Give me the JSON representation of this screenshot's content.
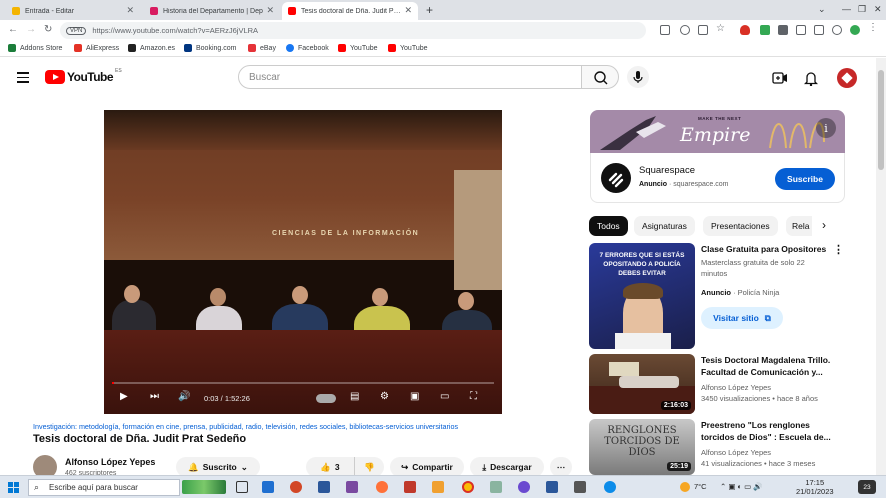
{
  "browser": {
    "tabs": [
      {
        "title": "Entrada - Editar",
        "color": "#f4b400"
      },
      {
        "title": "Historia del Departamento | Dep",
        "color": "#d81b60"
      },
      {
        "title": "Tesis doctoral de Dña. Judit Prat",
        "color": "#ff0000",
        "active": true
      }
    ],
    "new_tab": "+",
    "url": "https://www.youtube.com/watch?v=AERzJ6jVLRA",
    "url_badge": "VPN",
    "bookmarks": [
      {
        "label": "Addons Store",
        "color": "#1b7d3a"
      },
      {
        "label": "AliExpress",
        "color": "#e43226"
      },
      {
        "label": "Amazon.es",
        "color": "#222222"
      },
      {
        "label": "Booking.com",
        "color": "#003580"
      },
      {
        "label": "eBay",
        "color": "#e53238"
      },
      {
        "label": "Facebook",
        "color": "#1877f2"
      },
      {
        "label": "YouTube",
        "color": "#ff0000"
      },
      {
        "label": "YouTube",
        "color": "#ff0000"
      }
    ]
  },
  "youtube": {
    "logo_text": "YouTube",
    "country_code": "ES",
    "search_placeholder": "Buscar"
  },
  "player": {
    "banner_text": "CIENCIAS DE LA INFORMACIÓN",
    "time": "0:03 / 1:52:26",
    "progress": 0.0004
  },
  "video": {
    "hashtags": "Investigación: metodología, formación en cine, prensa, publicidad, radio, televisión, redes sociales, bibliotecas-servicios universitarios",
    "title": "Tesis doctoral de Dña. Judit Prat Sedeño",
    "channel": "Alfonso López Yepes",
    "subscribers": "462 suscriptores",
    "subscribed_label": "Suscrito",
    "likes": "3",
    "share_label": "Compartir",
    "download_label": "Descargar"
  },
  "ad": {
    "banner_small": "MAKE THE NEXT",
    "banner_big": "Empire",
    "name": "Squarespace",
    "sponsor_label": "Anuncio",
    "domain": "squarespace.com",
    "button": "Suscribe"
  },
  "chips": [
    "Todos",
    "Asignaturas",
    "Presentaciones",
    "Rela"
  ],
  "recommendations": [
    {
      "title": "Clase Gratuita para Opositores",
      "line1": "Masterclass gratuita de solo 22 minutos",
      "sponsor_label": "Anuncio",
      "sponsor": "Policía Ninja",
      "cta": "Visitar sitio",
      "thumb_text": "7 ERRORES QUE SI ESTÁS OPOSITANDO A POLICÍA DEBES EVITAR"
    },
    {
      "title": "Tesis Doctoral Magdalena Trillo. Facultad de Comunicación y...",
      "channel": "Alfonso López Yepes",
      "meta": "3450 visualizaciones • hace 8 años",
      "duration": "2:16:03"
    },
    {
      "title": "Preestreno \"Los renglones torcidos de Dios\" : Escuela de...",
      "channel": "Alfonso López Yepes",
      "meta": "41 visualizaciones • hace 3 meses",
      "duration": "25:19",
      "thumb_text": "RENGLONES TORCIDOS DE DIOS"
    }
  ],
  "taskbar": {
    "search_placeholder": "Escribe aquí para buscar",
    "weather": "7°C",
    "time": "17:15",
    "date": "21/01/2023",
    "notification_count": "23"
  }
}
